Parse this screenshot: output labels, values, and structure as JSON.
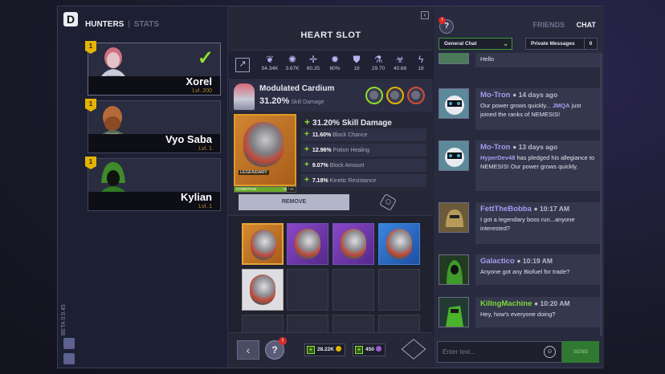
{
  "left": {
    "tabs": {
      "hunters": "HUNTERS",
      "stats": "STATS"
    },
    "hunters": [
      {
        "name": "Xorel",
        "level": "Lvl. 200",
        "badge": "1",
        "selected": true
      },
      {
        "name": "Vyo Saba",
        "level": "Lvl. 1",
        "badge": "1",
        "selected": false
      },
      {
        "name": "Kylian",
        "level": "Lvl. 1",
        "badge": "1",
        "selected": false
      }
    ],
    "version": "BETA 0.9.45"
  },
  "center": {
    "title": "HEART SLOT",
    "stats": [
      {
        "icon": "dna-icon",
        "value": "54.34K"
      },
      {
        "icon": "swirl-icon",
        "value": "3.67K"
      },
      {
        "icon": "crosshair-icon",
        "value": "60.35"
      },
      {
        "icon": "gear-icon",
        "value": "60%"
      },
      {
        "icon": "shield-icon",
        "value": "18"
      },
      {
        "icon": "flask-icon",
        "value": "29.70"
      },
      {
        "icon": "biohazard-icon",
        "value": "40.68"
      },
      {
        "icon": "bolt-icon",
        "value": "18"
      }
    ],
    "module": {
      "name": "Modulated Cardium",
      "pct": "31.20",
      "pct_unit": "%",
      "pct_label": "Skill Damage",
      "rarity": "LEGENDARY",
      "condition_label": "CONDITION",
      "condition_value": "35 / 41",
      "condition_fraction": 0.85,
      "main_bonus": "31.20% Skill Damage",
      "bonuses": [
        {
          "pct": "11.60%",
          "label": "Block Chance"
        },
        {
          "pct": "12.96%",
          "label": "Potion Healing"
        },
        {
          "pct": "9.07%",
          "label": "Block Amount"
        },
        {
          "pct": "7.18%",
          "label": "Kinetic Resistance"
        }
      ],
      "gem_colors": [
        "#8fe02c",
        "#e6b400",
        "#d84a3a"
      ]
    },
    "remove_label": "REMOVE",
    "help_notif": "!",
    "currency": [
      {
        "value": "28.22K",
        "coin_color": "#e6b400"
      },
      {
        "value": "450",
        "coin_color": "#a35ad8"
      }
    ]
  },
  "right": {
    "help_notif": "!",
    "tabs": {
      "friends": "FRIENDS",
      "chat": "CHAT"
    },
    "channel": "General Chat",
    "private_messages": "Private Messages",
    "private_count": "0",
    "messages": [
      {
        "user": "",
        "time": "",
        "text": "Hello"
      },
      {
        "user": "Mo-Tron",
        "time": "● 14 days ago",
        "text_pre": "Our power grows quickly... ",
        "text_hl": "JMQA",
        "text_post": " just joined the ranks of NEMESIS!"
      },
      {
        "user": "Mo-Tron",
        "time": "● 13 days ago",
        "text_pre": "",
        "text_hl": "HyperDev48",
        "text_post": " has pledged his allegiance to NEMESIS! Our power grows quickly."
      },
      {
        "user": "FettTheBobba",
        "time": "● 10:17 AM",
        "text": "I got a legendary boss run...anyone interested?"
      },
      {
        "user": "Galactico",
        "time": "● 10:19 AM",
        "text": "Anyone got any Biofuel for trade?"
      },
      {
        "user": "KillngMachine",
        "time": "● 10:20 AM",
        "text": "Hey, how's everyone doing?"
      }
    ],
    "input_placeholder": "Enter text...",
    "send_label": "SEND"
  }
}
